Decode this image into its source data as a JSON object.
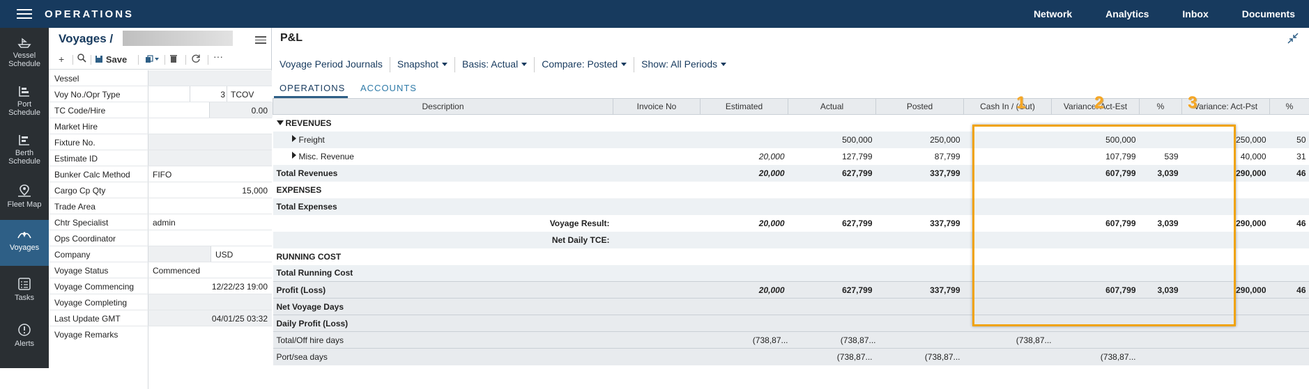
{
  "app": {
    "title": "OPERATIONS",
    "nav": [
      "Network",
      "Analytics",
      "Inbox",
      "Documents"
    ]
  },
  "leftnav": [
    {
      "label1": "Vessel",
      "label2": "Schedule",
      "icon": "ship-icon"
    },
    {
      "label1": "Port",
      "label2": "Schedule",
      "icon": "port-schedule-icon"
    },
    {
      "label1": "Berth",
      "label2": "Schedule",
      "icon": "berth-schedule-icon"
    },
    {
      "label1": "Fleet Map",
      "label2": "",
      "icon": "map-pin-icon"
    },
    {
      "label1": "Voyages",
      "label2": "",
      "icon": "voyages-icon"
    },
    {
      "label1": "Tasks",
      "label2": "",
      "icon": "tasks-icon"
    },
    {
      "label1": "Alerts",
      "label2": "",
      "icon": "alert-icon"
    }
  ],
  "voyage_panel": {
    "title": "Voyages /",
    "save_label": "Save",
    "fields": [
      {
        "label": "Vessel",
        "value": ""
      },
      {
        "label": "Voy No./Opr Type",
        "value": "3",
        "value2": "TCOV"
      },
      {
        "label": "TC Code/Hire",
        "value": "0.00"
      },
      {
        "label": "Market Hire",
        "value": ""
      },
      {
        "label": "Fixture No.",
        "value": ""
      },
      {
        "label": "Estimate ID",
        "value": ""
      },
      {
        "label": "Bunker Calc Method",
        "value": "FIFO"
      },
      {
        "label": "Cargo Cp Qty",
        "value": "15,000"
      },
      {
        "label": "Trade Area",
        "value": ""
      },
      {
        "label": "Chtr Specialist",
        "value": "admin"
      },
      {
        "label": "Ops Coordinator",
        "value": ""
      },
      {
        "label": "Company",
        "value": "USD"
      },
      {
        "label": "Voyage Status",
        "value": "Commenced"
      },
      {
        "label": "Voyage Commencing",
        "value": "12/22/23 19:00"
      },
      {
        "label": "Voyage Completing",
        "value": ""
      },
      {
        "label": "Last Update GMT",
        "value": "04/01/25 03:32"
      },
      {
        "label": "Voyage Remarks",
        "value": ""
      }
    ]
  },
  "pl": {
    "title": "P&L",
    "toolbar": [
      "Voyage Period Journals",
      "Snapshot",
      "Basis: Actual",
      "Compare: Posted",
      "Show: All Periods"
    ],
    "tabs": [
      "OPERATIONS",
      "ACCOUNTS"
    ],
    "markers": [
      "1",
      "2",
      "3"
    ],
    "columns": [
      "Description",
      "Invoice No",
      "Estimated",
      "Actual",
      "Posted",
      "Cash In / (Out)",
      "Variance: Act-Est",
      "%",
      "Variance: Act-Pst",
      "%"
    ],
    "rows": [
      {
        "desc": "REVENUES",
        "est": "",
        "act": "",
        "pst": "",
        "vae": "",
        "pe": "",
        "vap": "",
        "pp": ""
      },
      {
        "desc": "Freight",
        "est": "",
        "act": "500,000",
        "pst": "250,000",
        "vae": "500,000",
        "pe": "",
        "vap": "250,000",
        "pp": "50"
      },
      {
        "desc": "Misc. Revenue",
        "est": "20,000",
        "act": "127,799",
        "pst": "87,799",
        "vae": "107,799",
        "pe": "539",
        "vap": "40,000",
        "pp": "31"
      },
      {
        "desc": "Total Revenues",
        "est": "20,000",
        "act": "627,799",
        "pst": "337,799",
        "vae": "607,799",
        "pe": "3,039",
        "vap": "290,000",
        "pp": "46"
      },
      {
        "desc": "EXPENSES",
        "est": "",
        "act": "",
        "pst": "",
        "vae": "",
        "pe": "",
        "vap": "",
        "pp": ""
      },
      {
        "desc": "Total Expenses",
        "est": "",
        "act": "",
        "pst": "",
        "vae": "",
        "pe": "",
        "vap": "",
        "pp": ""
      },
      {
        "desc": "Voyage Result:",
        "est": "20,000",
        "act": "627,799",
        "pst": "337,799",
        "vae": "607,799",
        "pe": "3,039",
        "vap": "290,000",
        "pp": "46"
      },
      {
        "desc": "Net Daily TCE:",
        "est": "",
        "act": "",
        "pst": "",
        "vae": "",
        "pe": "",
        "vap": "",
        "pp": ""
      },
      {
        "desc": "RUNNING COST",
        "est": "",
        "act": "",
        "pst": "",
        "vae": "",
        "pe": "",
        "vap": "",
        "pp": ""
      },
      {
        "desc": "Total Running Cost",
        "est": "",
        "act": "",
        "pst": "",
        "vae": "",
        "pe": "",
        "vap": "",
        "pp": ""
      },
      {
        "desc": "Profit (Loss)",
        "est": "20,000",
        "act": "627,799",
        "pst": "337,799",
        "vae": "607,799",
        "pe": "3,039",
        "vap": "290,000",
        "pp": "46"
      },
      {
        "desc": "Net Voyage Days",
        "est": "",
        "act": "",
        "pst": "",
        "vae": "",
        "pe": "",
        "vap": "",
        "pp": ""
      },
      {
        "desc": "Daily Profit (Loss)",
        "est": "",
        "act": "",
        "pst": "",
        "vae": "",
        "pe": "",
        "vap": "",
        "pp": ""
      },
      {
        "desc": "Total/Off hire days",
        "est": "(738,87...",
        "act": "(738,87...",
        "pst": "",
        "vae": "(738,87...",
        "pe": "",
        "vap": "",
        "pp": ""
      },
      {
        "desc": "Port/sea days",
        "est": "",
        "act": "(738,87...",
        "pst": "(738,87...",
        "vae": "(738,87...",
        "pe": "",
        "vap": "",
        "pp": ""
      }
    ]
  }
}
